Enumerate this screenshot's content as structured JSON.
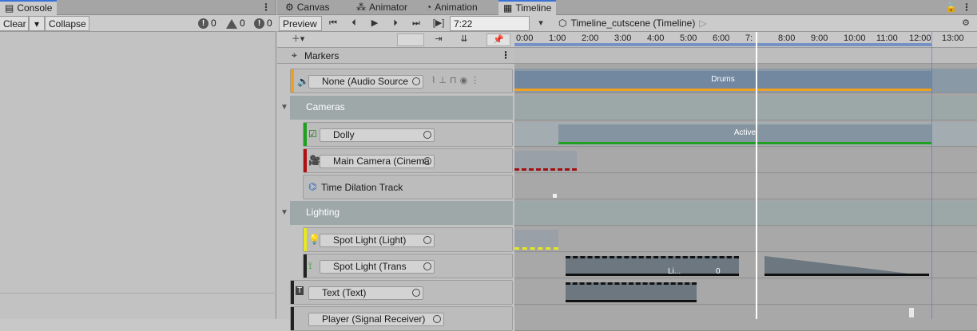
{
  "console": {
    "tab_label": "Console",
    "clear_label": "Clear",
    "collapse_label": "Collapse",
    "info_count": "0",
    "warning_count": "0",
    "error_count": "0"
  },
  "timeline": {
    "tabs": [
      {
        "label": "Canvas"
      },
      {
        "label": "Animator"
      },
      {
        "label": "Animation"
      },
      {
        "label": "Timeline"
      }
    ],
    "preview_label": "Preview",
    "time_value": "7:22",
    "frame_indicator": "[▶]",
    "breadcrumb": "Timeline_cutscene (Timeline)",
    "markers_label": "Markers",
    "ruler_ticks": [
      "0:00",
      "1:00",
      "2:00",
      "3:00",
      "4:00",
      "5:00",
      "6:00",
      "7:",
      "8:00",
      "9:00",
      "10:00",
      "11:00",
      "12:00",
      "13:00"
    ],
    "tracks": [
      {
        "kind": "track",
        "label": "None (Audio Source",
        "color": "#f0a020"
      },
      {
        "kind": "group",
        "label": "Cameras"
      },
      {
        "kind": "track",
        "label": "Dolly",
        "color": "#20a020"
      },
      {
        "kind": "track",
        "label": "Main Camera (Cinema",
        "color": "#b01010"
      },
      {
        "kind": "track",
        "label": "Time Dilation Track",
        "color": ""
      },
      {
        "kind": "group",
        "label": "Lighting"
      },
      {
        "kind": "track",
        "label": "Spot Light (Light)",
        "color": "#e8e820"
      },
      {
        "kind": "track",
        "label": "Spot Light (Trans",
        "color": "#222222"
      },
      {
        "kind": "track",
        "label": "Text (Text)",
        "color": "#222222"
      },
      {
        "kind": "track",
        "label": "Player (Signal Receiver)",
        "color": "#222222"
      }
    ],
    "clips": {
      "drums_label": "Drums",
      "active_label": "Active",
      "li_label": "Li...",
      "zero_label": "0"
    }
  }
}
